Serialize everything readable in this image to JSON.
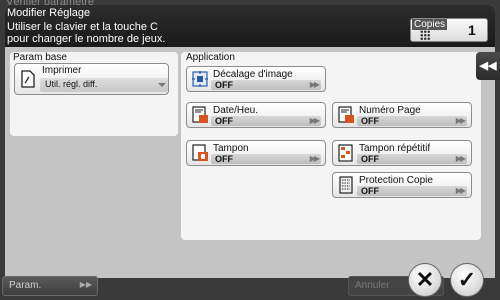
{
  "background": {
    "title": "Vérifier paramètre",
    "param_button": "Param.",
    "annuler_button": "Annuler"
  },
  "header": {
    "title": "Modifier Réglage",
    "message_line1": "Utiliser le clavier et la touche C",
    "message_line2": "pour changer le nombre de jeux.",
    "copies_label": "Copies",
    "copies_value": "1"
  },
  "base_panel": {
    "label": "Param base",
    "printer": {
      "title": "Imprimer",
      "value": "Util. régl. diff."
    }
  },
  "application_panel": {
    "label": "Application",
    "items": [
      {
        "title": "Décalage d'image",
        "value": "OFF"
      },
      {
        "title": "Date/Heu.",
        "value": "OFF"
      },
      {
        "title": "Numéro Page",
        "value": "OFF"
      },
      {
        "title": "Tampon",
        "value": "OFF"
      },
      {
        "title": "Tampon répétitif",
        "value": "OFF"
      },
      {
        "title": "Protection Copie",
        "value": "OFF"
      }
    ]
  },
  "side_tab": {
    "label": "◀◀"
  },
  "actions": {
    "cancel": "✕",
    "ok": "✓"
  },
  "colors": {
    "header_bg": "#1f1f1f",
    "dialog_bg": "#c4c4c4",
    "panel_bg": "#f4f4f4"
  }
}
